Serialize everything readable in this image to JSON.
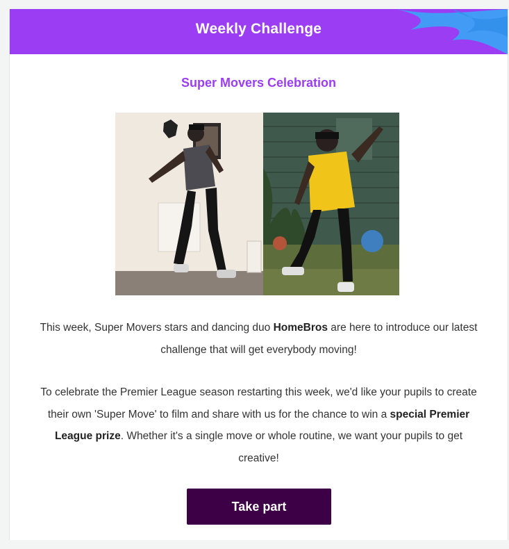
{
  "header": {
    "title": "Weekly Challenge",
    "accent_color": "#9a3df3"
  },
  "content": {
    "subtitle": "Super Movers Celebration",
    "photo": {
      "icon": "photo-of-two-dancers-icon",
      "left_caption": "",
      "right_caption": ""
    },
    "paragraph1": {
      "part1": "This week, Super Movers stars and dancing duo ",
      "bold": "HomeBros",
      "part2": " are here to introduce our latest challenge that will get everybody moving!"
    },
    "paragraph2": {
      "part1": "To celebrate the Premier League season restarting this week, we'd like your pupils to create their own 'Super Move' to film and share with us for the chance to win a ",
      "bold": "special Premier League prize",
      "part2": ". Whether it's a single move or whole routine, we want your pupils to get creative!"
    }
  },
  "cta": {
    "label": "Take part",
    "color": "#3d0047"
  }
}
